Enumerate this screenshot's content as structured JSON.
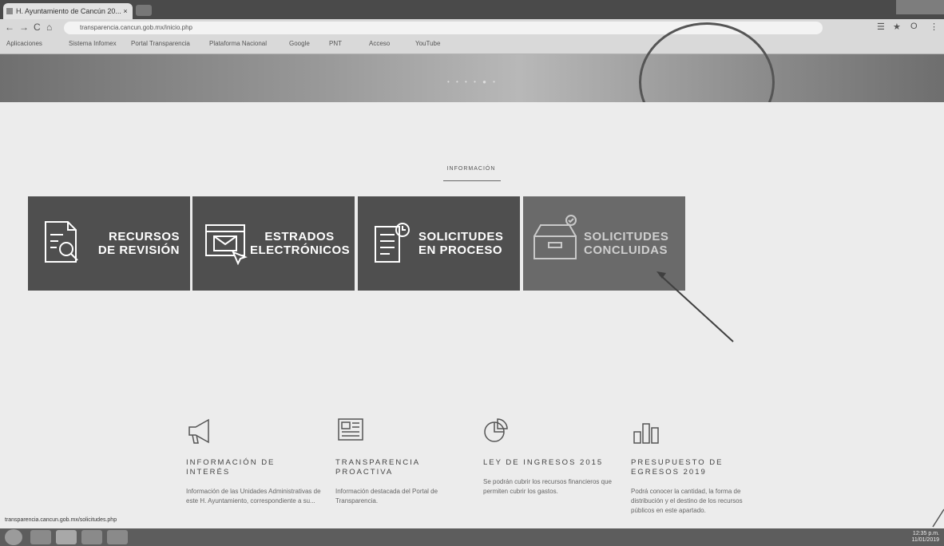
{
  "browser": {
    "tab_title": "H. Ayuntamiento de Cancún 20... ×",
    "tab_close": "×",
    "url": "transparencia.cancun.gob.mx/inicio.php",
    "nav": {
      "back": "←",
      "forward": "→",
      "reload": "C",
      "home": "⌂"
    },
    "right_icons": {
      "extensions": "☰",
      "star": "★",
      "profile": "O",
      "menu": "⋮"
    },
    "bookmarks": [
      "Aplicaciones",
      "Sistema Infomex",
      "Portal Transparencia",
      "Plataforma Nacional",
      "Google",
      "PNT",
      "Acceso",
      "YouTube"
    ]
  },
  "hero": {
    "indicator": "• • • • ● •"
  },
  "section": {
    "title": "INFORMACIÓN"
  },
  "cards": [
    {
      "line1": "RECURSOS",
      "line2": "DE REVISIÓN"
    },
    {
      "line1": "ESTRADOS",
      "line2": "ELECTRÓNICOS"
    },
    {
      "line1": "SOLICITUDES",
      "line2": "EN PROCESO"
    },
    {
      "line1": "SOLICITUDES",
      "line2": "CONCLUIDAS"
    }
  ],
  "features": [
    {
      "title": "INFORMACIÓN DE INTERÉS",
      "desc": "Información de las Unidades Administrativas de este H. Ayuntamiento, correspondiente a su..."
    },
    {
      "title": "TRANSPARENCIA PROACTIVA",
      "desc": "Información destacada del Portal de Transparencia."
    },
    {
      "title": "LEY DE INGRESOS 2015",
      "desc": "Se podrán cubrir los recursos financieros que permiten cubrir los gastos."
    },
    {
      "title": "PRESUPUESTO DE EGRESOS 2019",
      "desc": "Podrá conocer la cantidad, la forma de distribución y el destino de los recursos públicos en este apartado."
    }
  ],
  "status_url": "transparencia.cancun.gob.mx/solicitudes.php",
  "taskbar": {
    "time": "12:35 p.m.",
    "date": "11/01/2019"
  },
  "colors": {
    "card_bg": "#4f4f4f",
    "page_bg": "#ececec"
  }
}
